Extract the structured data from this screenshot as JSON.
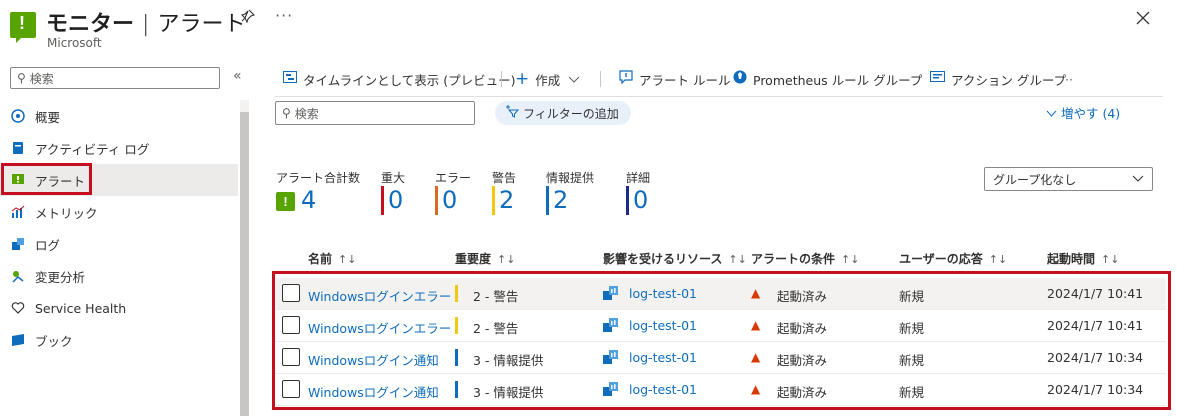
{
  "header": {
    "title_main": "モニター",
    "title_sep": "|",
    "title_sub": "アラート",
    "subtitle": "Microsoft",
    "more": "···"
  },
  "sidebar": {
    "search_placeholder": "検索",
    "items": [
      {
        "label": "概要",
        "icon": "overview-icon"
      },
      {
        "label": "アクティビティ ログ",
        "icon": "activity-log-icon"
      },
      {
        "label": "アラート",
        "icon": "alert-icon"
      },
      {
        "label": "メトリック",
        "icon": "metrics-icon"
      },
      {
        "label": "ログ",
        "icon": "logs-icon"
      },
      {
        "label": "変更分析",
        "icon": "change-analysis-icon"
      },
      {
        "label": "Service Health",
        "icon": "heart-icon"
      },
      {
        "label": "ブック",
        "icon": "workbook-icon"
      }
    ]
  },
  "toolbar": {
    "timeline": "タイムラインとして表示 (プレビュー)",
    "create": "作成",
    "alert_rules": "アラート ルール",
    "prometheus": "Prometheus ルール グループ",
    "action_groups": "アクション グループ",
    "more": "···"
  },
  "filters": {
    "search_placeholder": "検索",
    "add_filter": "フィルターの追加",
    "increase": "増やす (4)"
  },
  "summary": {
    "total_label": "アラート合計数",
    "total": "4",
    "items": [
      {
        "label": "重大",
        "value": "0",
        "color": "#c50f1f"
      },
      {
        "label": "エラー",
        "value": "0",
        "color": "#d86b1f"
      },
      {
        "label": "警告",
        "value": "2",
        "color": "#f2c811"
      },
      {
        "label": "情報提供",
        "value": "2",
        "color": "#0f6cbd"
      },
      {
        "label": "詳細",
        "value": "0",
        "color": "#1c2a8a"
      }
    ],
    "group_by": "グループ化なし"
  },
  "table": {
    "columns": [
      "名前",
      "重要度",
      "影響を受けるリソース",
      "アラートの条件",
      "ユーザーの応答",
      "起動時間"
    ],
    "sort_icon": "↑↓",
    "rows": [
      {
        "name": "Windowsログインエラー",
        "severity": "2 - 警告",
        "sev_color": "#f2c811",
        "resource": "log-test-01",
        "condition": "起動済み",
        "response": "新規",
        "time": "2024/1/7 10:41"
      },
      {
        "name": "Windowsログインエラー",
        "severity": "2 - 警告",
        "sev_color": "#f2c811",
        "resource": "log-test-01",
        "condition": "起動済み",
        "response": "新規",
        "time": "2024/1/7 10:41"
      },
      {
        "name": "Windowsログイン通知",
        "severity": "3 - 情報提供",
        "sev_color": "#0f6cbd",
        "resource": "log-test-01",
        "condition": "起動済み",
        "response": "新規",
        "time": "2024/1/7 10:34"
      },
      {
        "name": "Windowsログイン通知",
        "severity": "3 - 情報提供",
        "sev_color": "#0f6cbd",
        "resource": "log-test-01",
        "condition": "起動済み",
        "response": "新規",
        "time": "2024/1/7 10:34"
      }
    ]
  }
}
